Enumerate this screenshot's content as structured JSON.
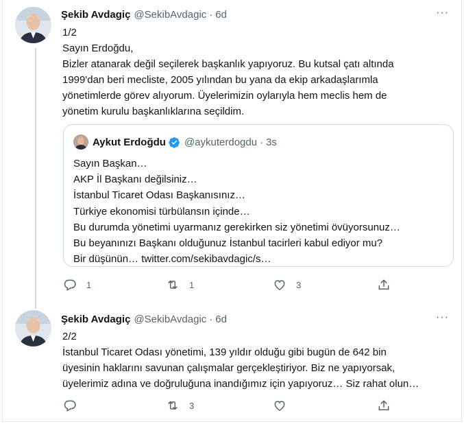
{
  "thread": {
    "tweets": [
      {
        "name": "Şekib Avdagiç",
        "handle": "@SekibAvdagic",
        "dot": "·",
        "time": "6d",
        "lines": [
          "1/2",
          "Sayın Erdoğdu,",
          "Bizler atanarak değil seçilerek başkanlık yapıyoruz. Bu kutsal çatı altında",
          "1999'dan beri mecliste, 2005 yılından bu yana da ekip arkadaşlarımla",
          "yönetimlerde görev alıyorum. Üyelerimizin oylarıyla hem meclis hem de",
          "yönetim kurulu başkanlıklarına seçildim."
        ],
        "quote": {
          "name": "Aykut Erdoğdu",
          "handle": "@aykuterdogdu",
          "dot": "·",
          "time": "3s",
          "lines": [
            "Sayın Başkan…",
            "AKP İl Başkanı değilsiniz…",
            "İstanbul Ticaret Odası Başkanısınız…",
            "Türkiye ekonomisi türbülansın içinde…",
            "Bu durumda yönetimi uyarmanız gerekirken siz yönetimi övüyorsunuz…",
            "Bu beyanınızı Başkanı olduğunuz İstanbul tacirleri kabul ediyor mu?",
            "Bir düşünün… twitter.com/sekibavdagic/s…"
          ]
        },
        "actions": {
          "replies": "1",
          "retweets": "1",
          "likes": "3"
        }
      },
      {
        "name": "Şekib Avdagiç",
        "handle": "@SekibAvdagic",
        "dot": "·",
        "time": "6d",
        "lines": [
          "2/2",
          "İstanbul Ticaret Odası yönetimi, 139 yıldır olduğu gibi bugün de 642 bin",
          "üyesinin haklarını savunan çalışmalar gerçekleştiriyor. Biz ne yapıyorsak,",
          "üyelerimiz adına ve doğruluğuna inandığımız için yapıyoruz… Siz rahat olun…"
        ],
        "actions": {
          "replies": "",
          "retweets": "3",
          "likes": ""
        }
      }
    ]
  },
  "icons": [
    "more-icon",
    "reply-icon",
    "retweet-icon",
    "like-icon",
    "share-icon",
    "verified-icon"
  ],
  "colors": {
    "text": "#0f1419",
    "muted": "#536471",
    "border": "#cfd9de",
    "verified": "#1d9bf0"
  }
}
